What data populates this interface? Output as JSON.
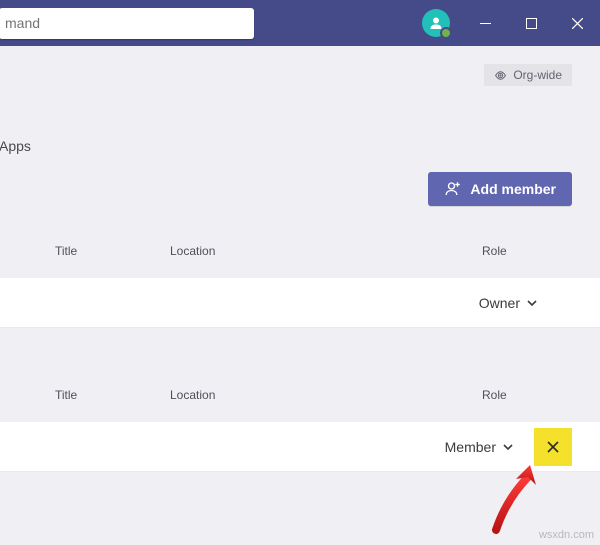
{
  "titlebar": {
    "search_text": "mand"
  },
  "badge": {
    "label": "Org-wide"
  },
  "tabs": {
    "apps": "Apps"
  },
  "actions": {
    "add_member": "Add member"
  },
  "columns": {
    "title": "Title",
    "location": "Location",
    "role": "Role"
  },
  "rows": {
    "owner": {
      "role": "Owner"
    },
    "member": {
      "role": "Member"
    }
  },
  "watermark": "wsxdn.com"
}
